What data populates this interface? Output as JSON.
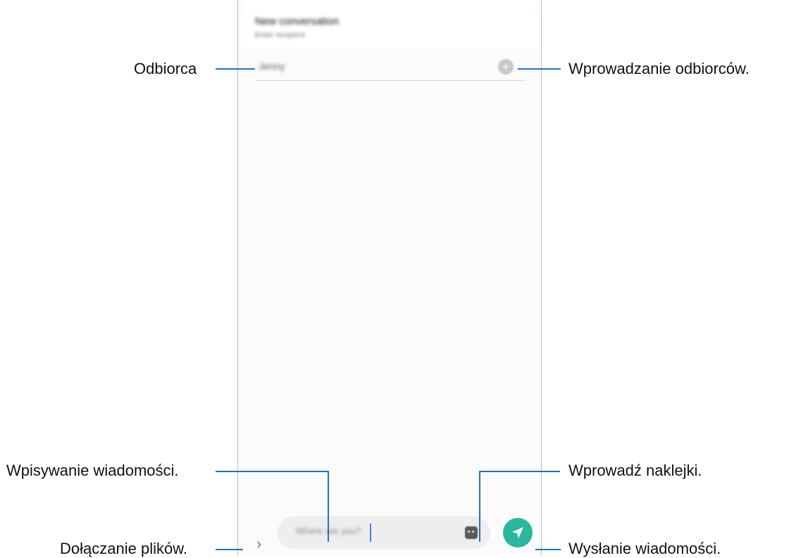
{
  "screen": {
    "header_title": "New conversation",
    "header_subtitle": "Enter recipient",
    "recipient_value": "Jenny",
    "add_recipient_icon": "plus-circle-icon",
    "message_placeholder": "Where are you?",
    "sticker_icon": "sticker-icon",
    "send_icon": "send-icon",
    "attach_icon": "chevron-right-icon",
    "send_color": "#2bb79e"
  },
  "callouts": {
    "recipient": "Odbiorca",
    "enter_recipients": "Wprowadzanie odbiorców.",
    "type_message": "Wpisywanie wiadomości.",
    "stickers": "Wprowadź naklejki.",
    "attach_files": "Dołączanie plików.",
    "send_message": "Wysłanie wiadomości."
  }
}
